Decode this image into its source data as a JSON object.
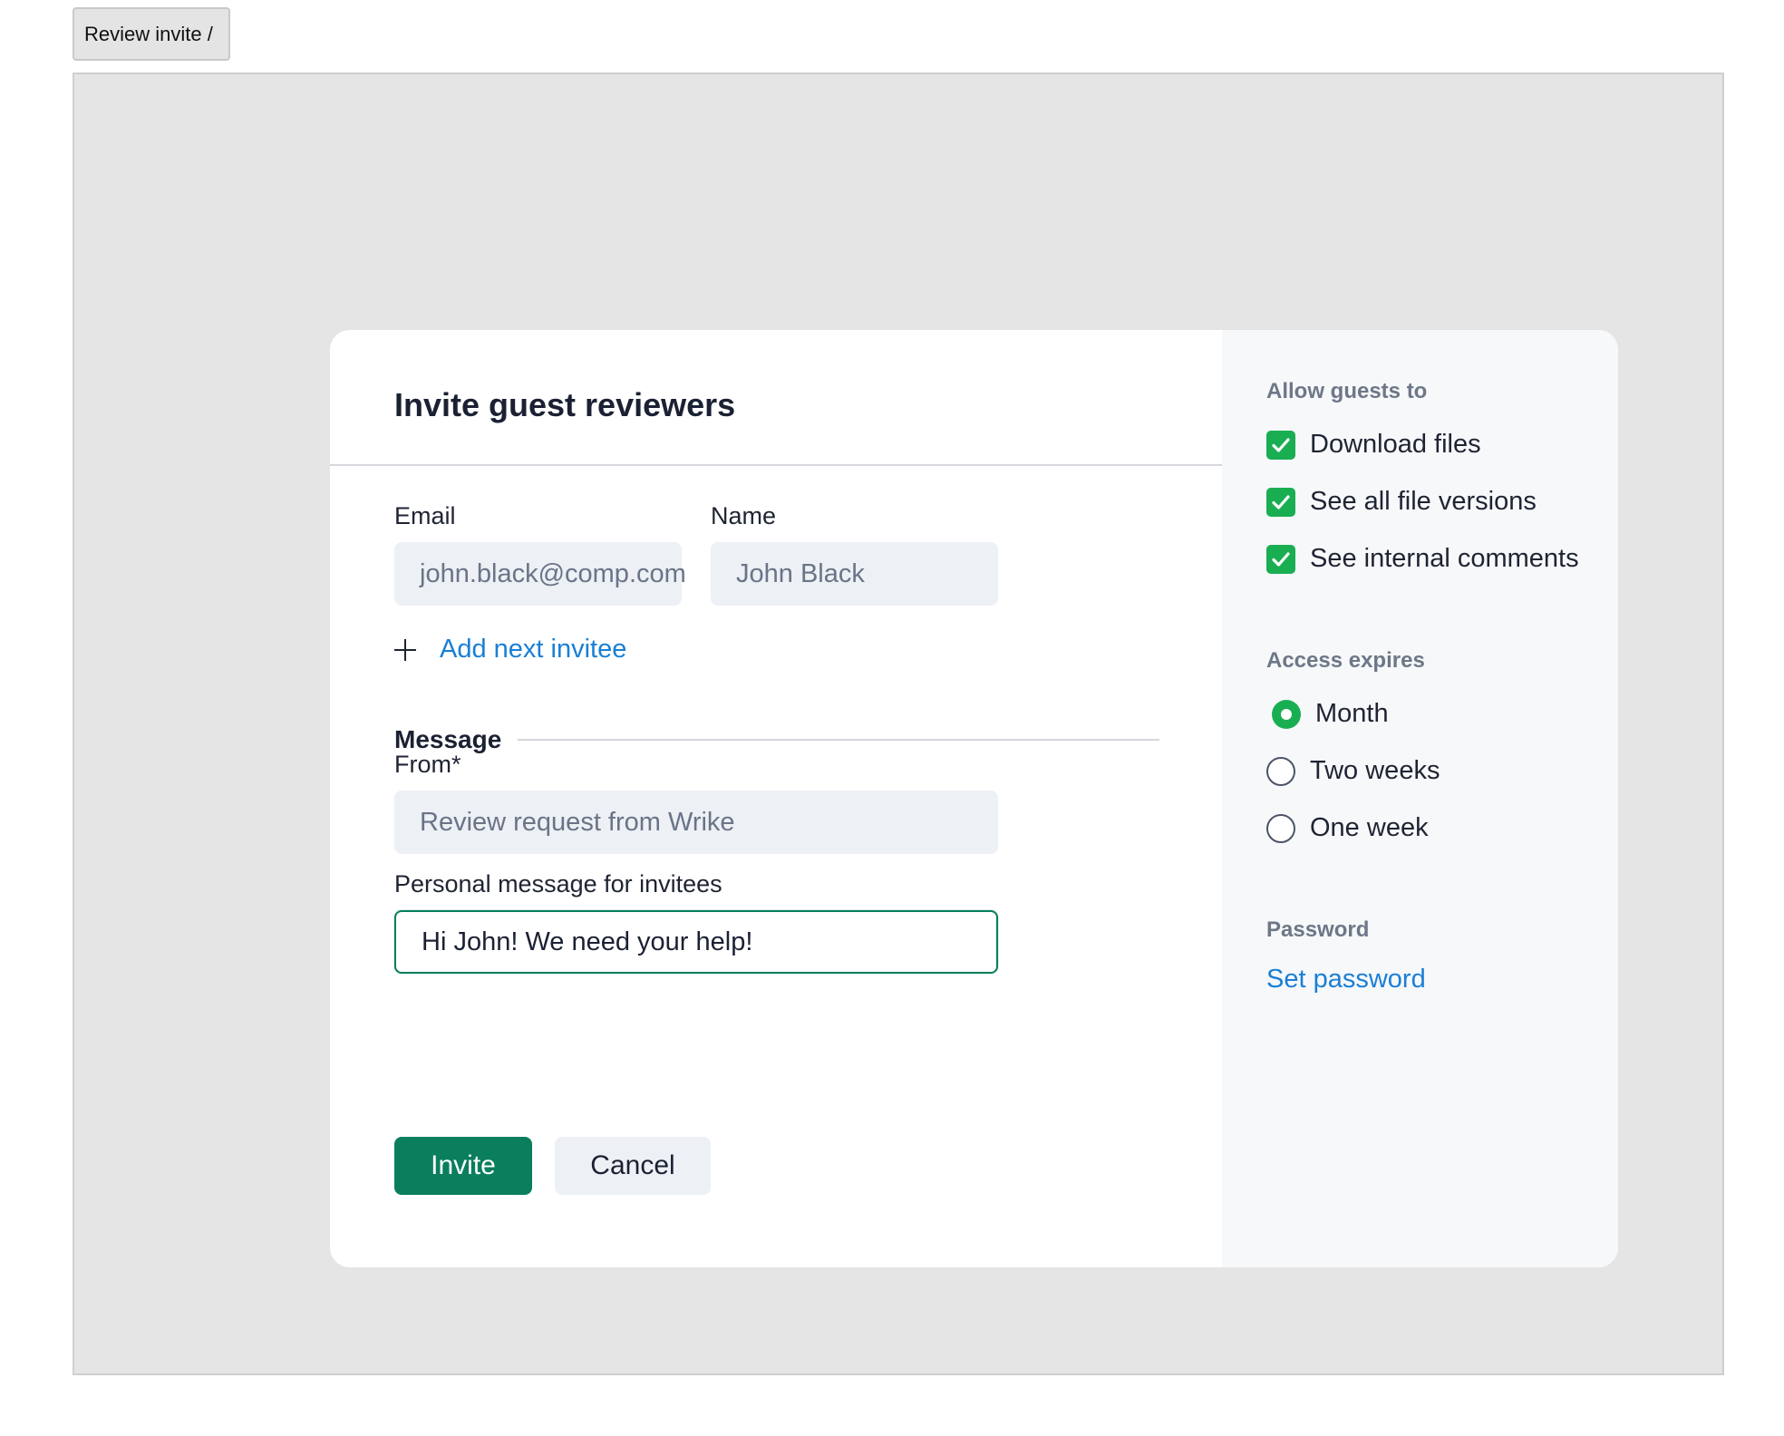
{
  "breadcrumb": {
    "label": "Review invite /"
  },
  "dialog": {
    "title": "Invite guest reviewers",
    "email": {
      "label": "Email",
      "placeholder": "john.black@comp.com"
    },
    "name": {
      "label": "Name",
      "placeholder": "John Black"
    },
    "add_invitee_label": "Add next invitee",
    "message_section_title": "Message",
    "from": {
      "label": "From*",
      "placeholder": "Review request from Wrike"
    },
    "personal_message": {
      "label": "Personal message for invitees",
      "value": "Hi John! We need your help!"
    },
    "invite_label": "Invite",
    "cancel_label": "Cancel"
  },
  "side_panel": {
    "permissions_heading": "Allow guests to",
    "permissions": [
      {
        "label": "Download files",
        "checked": true
      },
      {
        "label": "See all file versions",
        "checked": true
      },
      {
        "label": "See internal comments",
        "checked": true
      }
    ],
    "expiry_heading": "Access expires",
    "expiry_options": [
      {
        "label": "Month",
        "selected": true
      },
      {
        "label": "Two weeks",
        "selected": false
      },
      {
        "label": "One week",
        "selected": false
      }
    ],
    "password_heading": "Password",
    "set_password_label": "Set password"
  },
  "colors": {
    "accent_green": "#0a7e5d",
    "check_green": "#1aae52",
    "link_blue": "#1a7fd4"
  }
}
